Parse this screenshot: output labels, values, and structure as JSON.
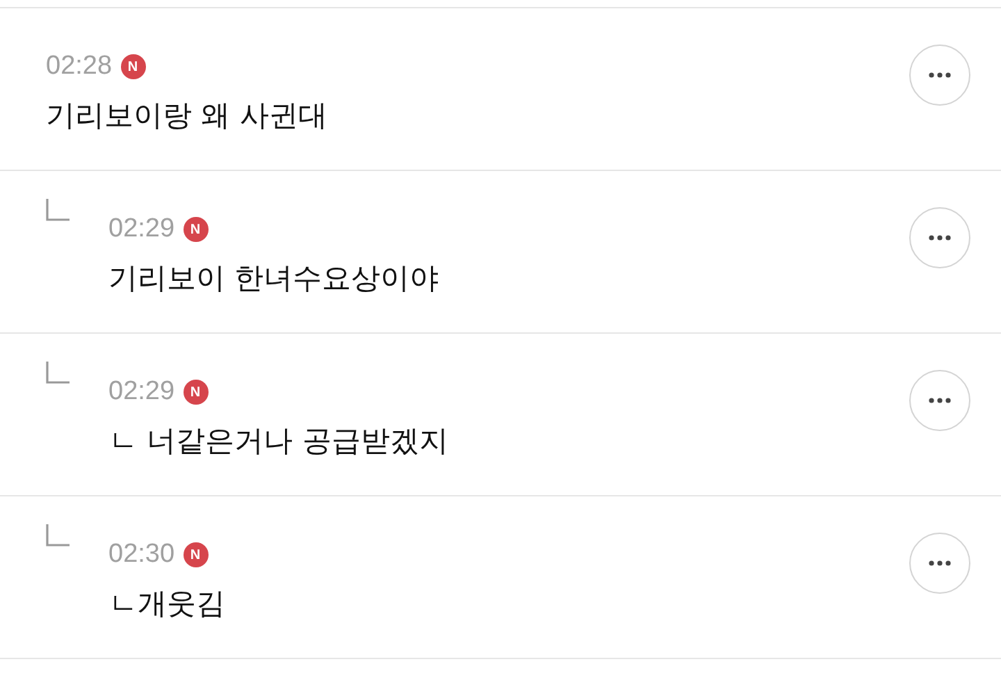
{
  "comments": [
    {
      "reply": false,
      "time": "02:28",
      "badge": "N",
      "text": "기리보이랑 왜 사귄대"
    },
    {
      "reply": true,
      "time": "02:29",
      "badge": "N",
      "text": "기리보이 한녀수요상이야"
    },
    {
      "reply": true,
      "time": "02:29",
      "badge": "N",
      "text": "ㄴ 너같은거나 공급받겠지"
    },
    {
      "reply": true,
      "time": "02:30",
      "badge": "N",
      "text": "ㄴ개웃김"
    }
  ]
}
